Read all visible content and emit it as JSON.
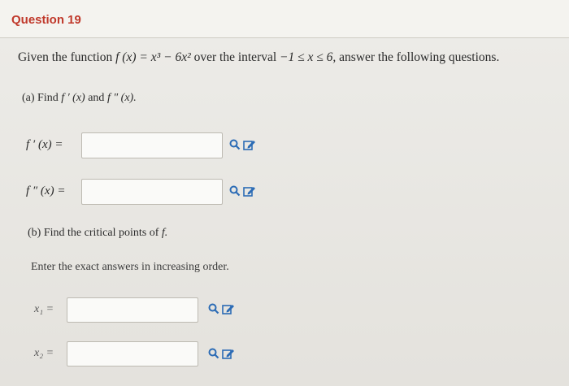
{
  "header": {
    "title": "Question 19"
  },
  "statement": {
    "prefix": "Given the function",
    "function_expr": "f (x) = x³ − 6x²",
    "middle": "over the interval",
    "interval": "−1 ≤ x ≤ 6,",
    "suffix": "answer the following questions."
  },
  "part_a": {
    "prefix": "(a) Find",
    "first": "f ′ (x)",
    "and": "and",
    "second": "f ″ (x).",
    "fprime_label": "f ′ (x) =",
    "fdoubleprime_label": "f ″ (x) =",
    "fprime_value": "",
    "fdoubleprime_value": ""
  },
  "part_b": {
    "prefix": "(b) Find the critical points of",
    "f": "f.",
    "instruction": "Enter the exact answers in increasing order.",
    "x1_label": "x₁ =",
    "x2_label": "x₂ =",
    "x1_value": "",
    "x2_value": ""
  },
  "icons": {
    "preview": "magnifier-icon",
    "edit": "edit-pencil-icon",
    "color": "#2b6bb5"
  }
}
